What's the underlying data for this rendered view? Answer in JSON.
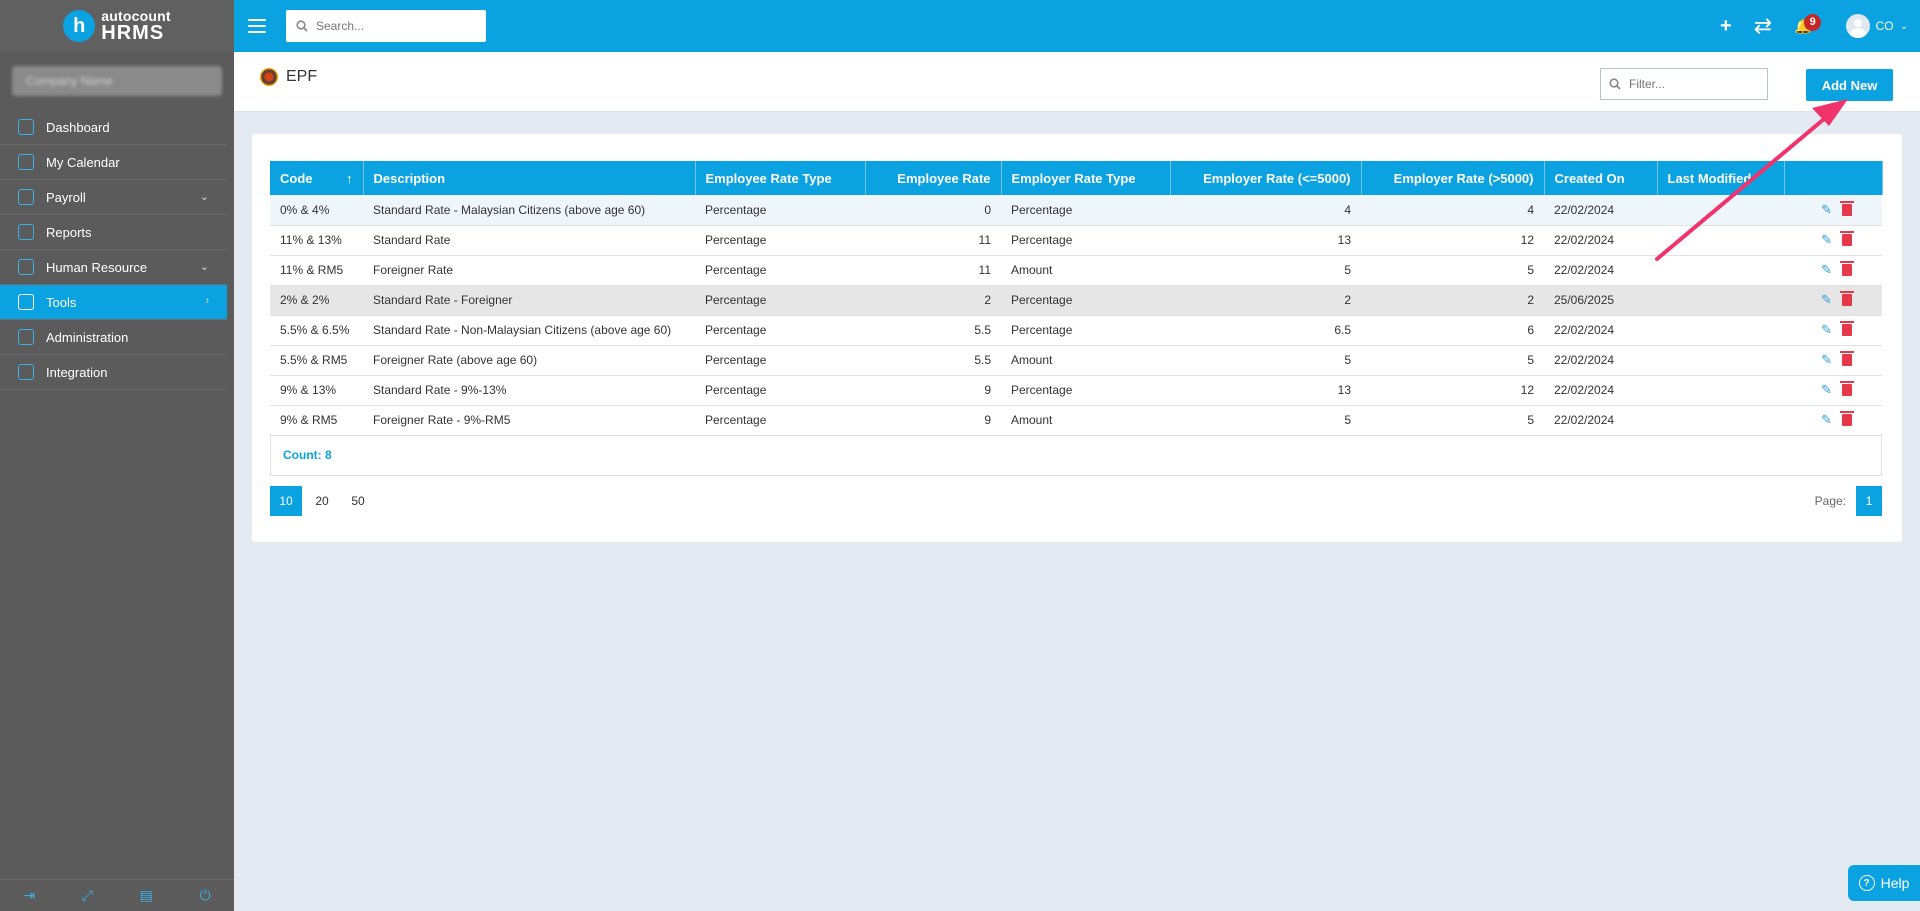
{
  "brand": {
    "small": "autocount",
    "big": "HRMS",
    "mark": "h"
  },
  "company": {
    "name": "Company Name"
  },
  "sidebar": {
    "items": [
      {
        "label": "Dashboard",
        "chevron": ""
      },
      {
        "label": "My Calendar",
        "chevron": ""
      },
      {
        "label": "Payroll",
        "chevron": "⌄"
      },
      {
        "label": "Reports",
        "chevron": ""
      },
      {
        "label": "Human Resource",
        "chevron": "⌄"
      },
      {
        "label": "Tools",
        "chevron": "›"
      },
      {
        "label": "Administration",
        "chevron": ""
      },
      {
        "label": "Integration",
        "chevron": ""
      }
    ],
    "footer_icons": [
      "logout-icon",
      "fullscreen-icon",
      "language-icon",
      "power-icon"
    ]
  },
  "topbar": {
    "search_placeholder": "Search...",
    "notification_count": "9",
    "user_initials": "CO"
  },
  "page": {
    "title": "EPF",
    "filter_placeholder": "Filter...",
    "add_label": "Add New"
  },
  "table": {
    "columns": [
      "Code",
      "Description",
      "Employee Rate Type",
      "Employee Rate",
      "Employer Rate Type",
      "Employer Rate (<=5000)",
      "Employer Rate (>5000)",
      "Created On",
      "Last Modified"
    ],
    "sort_indicator": "↑",
    "rows": [
      [
        "0% & 4%",
        "Standard Rate - Malaysian Citizens (above age 60)",
        "Percentage",
        "0",
        "Percentage",
        "4",
        "4",
        "22/02/2024",
        ""
      ],
      [
        "11% & 13%",
        "Standard Rate",
        "Percentage",
        "11",
        "Percentage",
        "13",
        "12",
        "22/02/2024",
        ""
      ],
      [
        "11% & RM5",
        "Foreigner Rate",
        "Percentage",
        "11",
        "Amount",
        "5",
        "5",
        "22/02/2024",
        ""
      ],
      [
        "2% & 2%",
        "Standard Rate - Foreigner",
        "Percentage",
        "2",
        "Percentage",
        "2",
        "2",
        "25/06/2025",
        ""
      ],
      [
        "5.5% & 6.5%",
        "Standard Rate - Non-Malaysian Citizens (above age 60)",
        "Percentage",
        "5.5",
        "Percentage",
        "6.5",
        "6",
        "22/02/2024",
        ""
      ],
      [
        "5.5% & RM5",
        "Foreigner Rate (above age 60)",
        "Percentage",
        "5.5",
        "Amount",
        "5",
        "5",
        "22/02/2024",
        ""
      ],
      [
        "9% & 13%",
        "Standard Rate - 9%-13%",
        "Percentage",
        "9",
        "Percentage",
        "13",
        "12",
        "22/02/2024",
        ""
      ],
      [
        "9% & RM5",
        "Foreigner Rate - 9%-RM5",
        "Percentage",
        "9",
        "Amount",
        "5",
        "5",
        "22/02/2024",
        ""
      ]
    ],
    "count_label": "Count: 8"
  },
  "pagination": {
    "page_sizes": [
      "10",
      "20",
      "50"
    ],
    "selected_size": "10",
    "page_label": "Page:",
    "current_page": "1"
  },
  "help": {
    "label": "Help"
  },
  "colors": {
    "accent": "#0aa2e0",
    "sidebar": "#5b5b5b",
    "delete": "#e53949",
    "arrow": "#f0336a"
  }
}
